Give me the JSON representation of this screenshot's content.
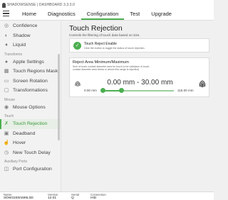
{
  "app": {
    "brand": "SHADOWSENSE | DASHBOARD 3.3.0.0",
    "tabs": [
      "Home",
      "Diagnostics",
      "Configuration",
      "Test",
      "Upgrade"
    ],
    "active_tab": "Configuration"
  },
  "sidebar": {
    "items": [
      {
        "type": "item",
        "label": "Confidence",
        "icon": "confidence-icon"
      },
      {
        "type": "item",
        "label": "Shadow",
        "icon": "shadow-icon"
      },
      {
        "type": "item",
        "label": "Liquid",
        "icon": "liquid-icon"
      },
      {
        "type": "section",
        "label": "Transforms"
      },
      {
        "type": "item",
        "label": "Apple Settings",
        "icon": "apple-icon"
      },
      {
        "type": "item",
        "label": "Touch Regions Mask",
        "icon": "regions-mask-icon"
      },
      {
        "type": "item",
        "label": "Screen Rotation",
        "icon": "screen-rotation-icon"
      },
      {
        "type": "item",
        "label": "Transformations",
        "icon": "transformations-icon"
      },
      {
        "type": "section",
        "label": "Mouse"
      },
      {
        "type": "item",
        "label": "Mouse Options",
        "icon": "mouse-icon"
      },
      {
        "type": "section",
        "label": "Touch"
      },
      {
        "type": "item",
        "label": "Touch Rejection",
        "icon": "touch-rejection-icon",
        "active": true
      },
      {
        "type": "item",
        "label": "Deadband",
        "icon": "deadband-icon"
      },
      {
        "type": "item",
        "label": "Hover",
        "icon": "hover-icon"
      },
      {
        "type": "item",
        "label": "New Touch Delay",
        "icon": "touch-delay-icon"
      },
      {
        "type": "section",
        "label": "Auxiliary Ports"
      },
      {
        "type": "item",
        "label": "Port Configuration",
        "icon": "port-icon"
      }
    ]
  },
  "main": {
    "title": "Touch Rejection",
    "subtitle": "Controls the filtering of touch data based on size.",
    "enable_card": {
      "title": "Touch Reject Enable",
      "description": "Click the button to toggle the status of touch rejection.",
      "enabled": true
    },
    "range_card": {
      "title": "Reject Area Minimum/Maximum",
      "description": "Size of touch contact diameter area for touch to be valid(size of touch contact diameter area below or above this range is rejected)",
      "readout": "0.00 mm - 30.00 mm",
      "min_label": "0.00 mm",
      "max_label": "115.00 mm",
      "range_min": 0,
      "range_max": 115,
      "value_low": 0,
      "value_high": 30
    }
  },
  "status": {
    "columns": [
      {
        "key": "Name",
        "value": "SDW315W1M6L0D"
      },
      {
        "key": "Version",
        "value": "12.01"
      },
      {
        "key": "Serial",
        "value": "Q"
      },
      {
        "key": "Connection",
        "value": "HID"
      }
    ]
  },
  "colors": {
    "accent": "#4caf50",
    "accent_light": "#9ccf9e",
    "active_bg": "#e7efe6"
  }
}
